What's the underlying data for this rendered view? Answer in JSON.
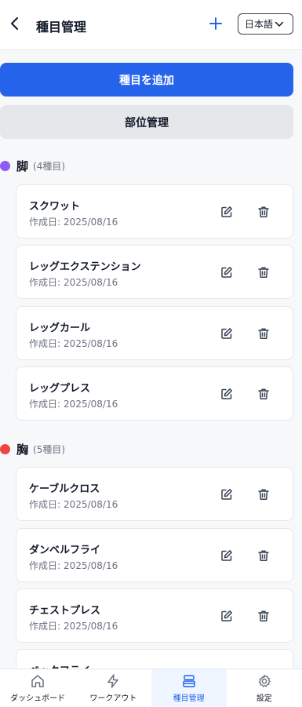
{
  "header": {
    "title": "種目管理",
    "language": "日本語"
  },
  "actions": {
    "add_exercise": "種目を追加",
    "manage_parts": "部位管理"
  },
  "date_label": "作成日:",
  "groups": [
    {
      "name": "脚",
      "count": "(4種目)",
      "color": "#8b5cf6",
      "items": [
        {
          "name": "スクワット",
          "date": "2025/08/16"
        },
        {
          "name": "レッグエクステンション",
          "date": "2025/08/16"
        },
        {
          "name": "レッグカール",
          "date": "2025/08/16"
        },
        {
          "name": "レッグプレス",
          "date": "2025/08/16"
        }
      ]
    },
    {
      "name": "胸",
      "count": "(5種目)",
      "color": "#ef4444",
      "items": [
        {
          "name": "ケーブルクロス",
          "date": "2025/08/16"
        },
        {
          "name": "ダンベルフライ",
          "date": "2025/08/16"
        },
        {
          "name": "チェストプレス",
          "date": "2025/08/16"
        },
        {
          "name": "ペックフライ",
          "date": ""
        }
      ]
    }
  ],
  "nav": [
    {
      "label": "ダッシュボード",
      "icon": "home-icon",
      "active": false
    },
    {
      "label": "ワークアウト",
      "icon": "bolt-icon",
      "active": false
    },
    {
      "label": "種目管理",
      "icon": "layers-icon",
      "active": true
    },
    {
      "label": "設定",
      "icon": "gear-icon",
      "active": false
    }
  ],
  "colors": {
    "accent": "#2563eb",
    "leg_dot": "#8b5cf6",
    "chest_dot": "#ef4444"
  }
}
